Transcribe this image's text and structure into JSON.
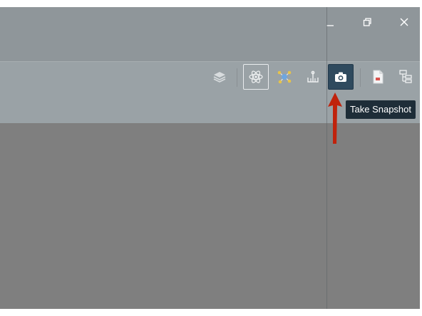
{
  "window": {
    "controls": [
      {
        "name": "minimize-icon"
      },
      {
        "name": "restore-icon"
      },
      {
        "name": "close-icon"
      }
    ]
  },
  "toolbar": {
    "buttons": [
      {
        "icon": "layers-icon",
        "state": "normal"
      },
      {
        "icon": "atom-icon",
        "state": "selected"
      },
      {
        "icon": "molecule-icon",
        "state": "normal"
      },
      {
        "icon": "anchor-icon",
        "state": "normal"
      },
      {
        "icon": "camera-icon",
        "state": "active"
      },
      {
        "icon": "document-icon",
        "state": "normal"
      },
      {
        "icon": "hierarchy-icon",
        "state": "normal"
      }
    ]
  },
  "tooltip": {
    "text": "Take Snapshot"
  },
  "annotation": {
    "arrow_color": "#c0220c"
  },
  "colors": {
    "titlebar": "#8f969a",
    "toolbar": "#9aa2a6",
    "canvas": "#7f7f7f",
    "active_button": "#2f4a5e",
    "tooltip_bg": "#1e2d38"
  }
}
